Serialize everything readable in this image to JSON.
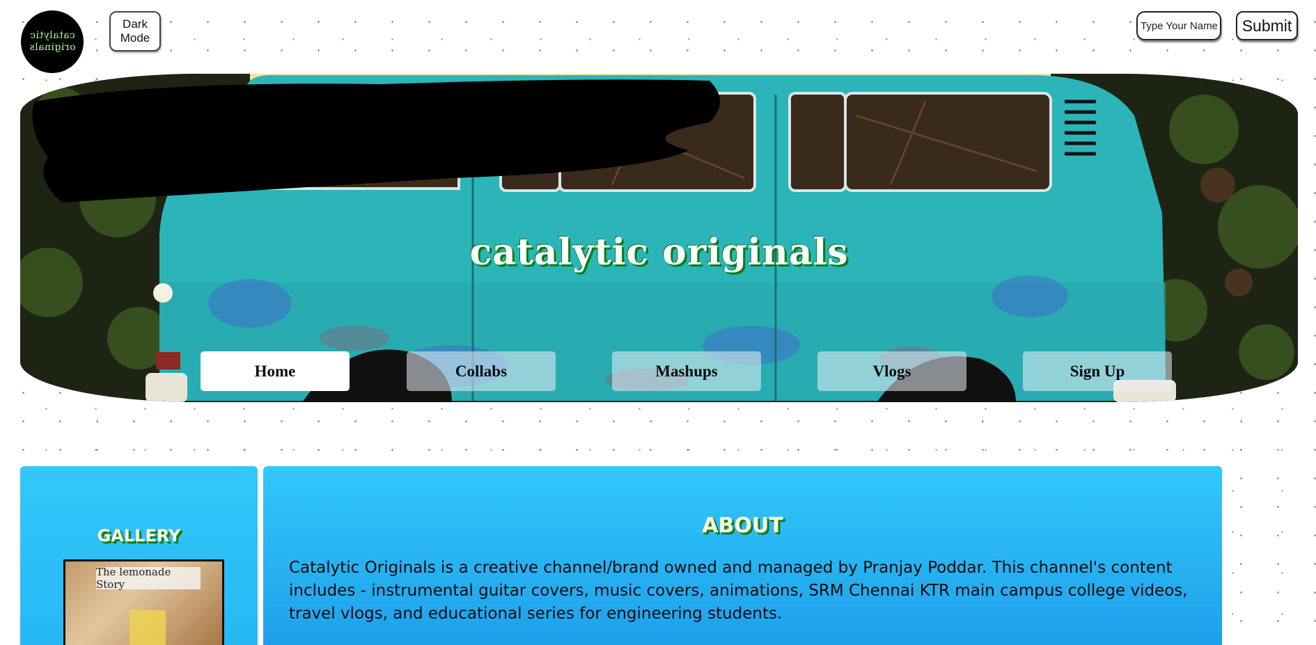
{
  "header": {
    "logo_text": "catalytic\noriginals",
    "dark_mode_label": "Dark\nMode",
    "name_placeholder": "Type Your Name",
    "submit_label": "Submit"
  },
  "hero": {
    "title": "catalytic originals",
    "nav": [
      {
        "label": "Home",
        "active": true
      },
      {
        "label": "Collabs",
        "active": false
      },
      {
        "label": "Mashups",
        "active": false
      },
      {
        "label": "Vlogs",
        "active": false
      },
      {
        "label": "Sign Up",
        "active": false
      }
    ]
  },
  "gallery": {
    "title": "GALLERY",
    "thumb_caption": "The lemonade Story"
  },
  "about": {
    "title": "ABOUT",
    "text": "Catalytic Originals is a creative channel/brand owned and managed by Pranjay Poddar. This channel's content includes - instrumental guitar covers, music covers, animations, SRM Chennai KTR main campus college videos, travel vlogs, and educational series for engineering students."
  },
  "colors": {
    "panel_blue": "#32c8fa",
    "title_green": "#1f8c22",
    "van_teal": "#2bb5b8"
  }
}
